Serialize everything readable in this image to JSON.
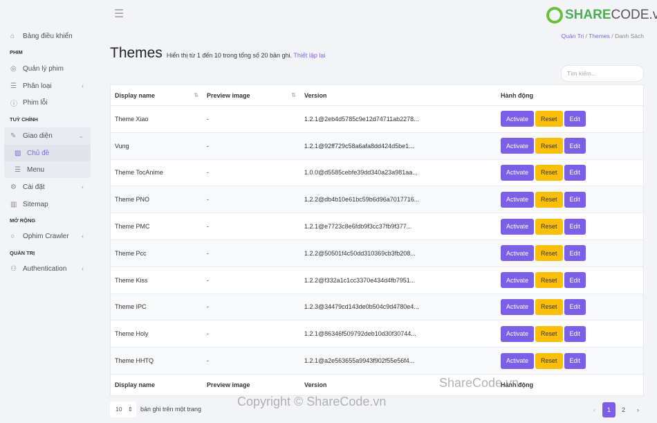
{
  "sidebar": {
    "dashboard": "Bảng điều khiển",
    "sections": [
      "PHIM",
      "TUỲ CHỈNH",
      "MỞ RỘNG",
      "QUẢN TRỊ"
    ],
    "movies": "Quản lý phim",
    "categories": "Phân loại",
    "broken": "Phim lỗi",
    "appearance": "Giao diện",
    "themes": "Chủ đề",
    "menu": "Menu",
    "settings": "Cài đặt",
    "sitemap": "Sitemap",
    "crawler": "Ophim Crawler",
    "auth": "Authentication"
  },
  "logo": {
    "text_a": "SHARE",
    "text_b": "CODE.vn"
  },
  "breadcrumb": [
    "Quản Trị",
    "Themes",
    "Danh Sách"
  ],
  "page": {
    "title": "Themes",
    "summary": "Hiển thị từ 1 đến 10 trong tổng số 20 bản ghi.",
    "reset_link": "Thiết lập lại"
  },
  "search": {
    "placeholder": "Tìm kiếm..."
  },
  "table": {
    "headers": [
      "Display name",
      "Preview image",
      "Version",
      "Hành động"
    ],
    "rows": [
      {
        "name": "Theme Xiao",
        "preview": "-",
        "version": "1.2.1@2eb4d5785c9e12d74711ab2278..."
      },
      {
        "name": "Vung",
        "preview": "-",
        "version": "1.2.1@92ff729c58a6afa8dd424d5be1..."
      },
      {
        "name": "Theme TocAnime",
        "preview": "-",
        "version": "1.0.0@d5585cebfe39dd340a23a981aa..."
      },
      {
        "name": "Theme PNO",
        "preview": "-",
        "version": "1.2.2@db4b10e61bc59b6d96a7017716..."
      },
      {
        "name": "Theme PMC",
        "preview": "-",
        "version": "1.2.1@e7723c8e6fdb9f3cc37fb9f377..."
      },
      {
        "name": "Theme Pcc",
        "preview": "-",
        "version": "1.2.2@50501f4c50dd310369cb3fb208..."
      },
      {
        "name": "Theme Kiss",
        "preview": "-",
        "version": "1.2.2@f332a1c1cc3370e434d4fb7951..."
      },
      {
        "name": "Theme IPC",
        "preview": "-",
        "version": "1.2.3@34479cd143de0b504c9d4780e4..."
      },
      {
        "name": "Theme Holy",
        "preview": "-",
        "version": "1.2.1@86346f509792deb10d30f30744..."
      },
      {
        "name": "Theme HHTQ",
        "preview": "-",
        "version": "1.2.1@a2e563655a9943f902f55e56f4..."
      }
    ],
    "actions": {
      "activate": "Activate",
      "reset": "Reset",
      "edit": "Edit"
    }
  },
  "footer": {
    "per_page": "10",
    "per_page_label": "bản ghi trên một trang",
    "pages": [
      "1",
      "2"
    ],
    "prev": "‹",
    "next": "›"
  },
  "watermarks": [
    "ShareCode.vn",
    "Copyright © ShareCode.vn"
  ],
  "colors": {
    "primary": "#7b5fe6",
    "warning": "#fcbf08"
  }
}
